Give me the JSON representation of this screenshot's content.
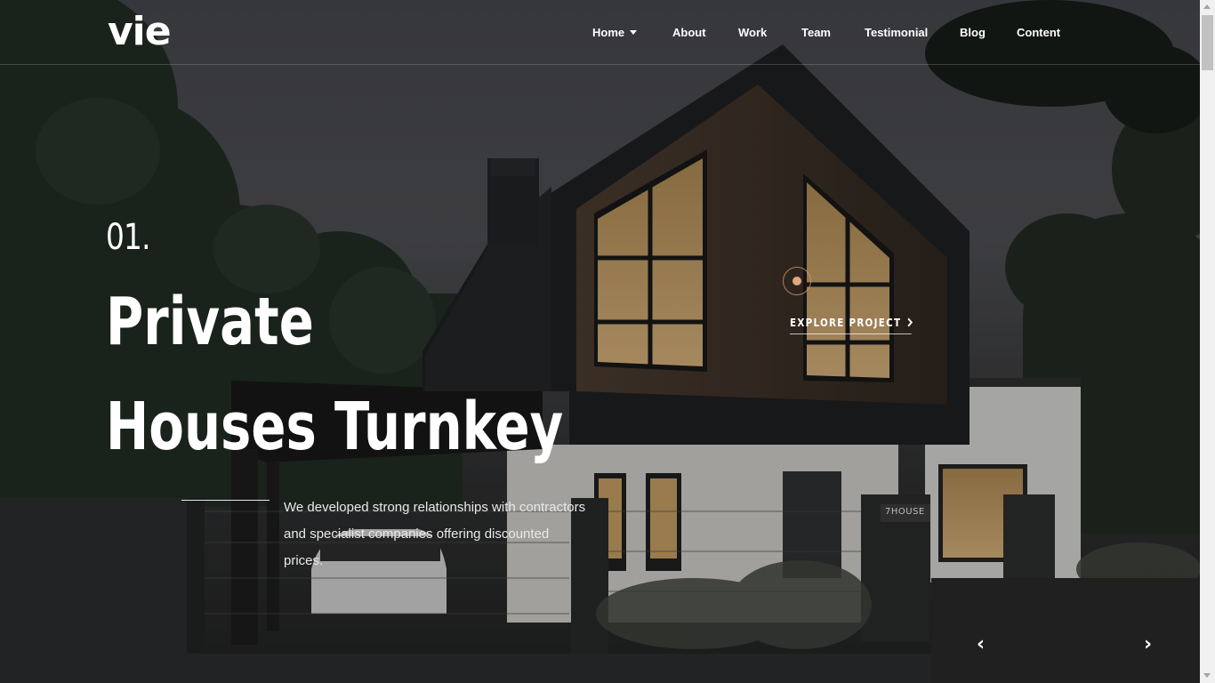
{
  "brand": {
    "logo_text": "vie"
  },
  "nav": {
    "items": [
      {
        "label": "Home",
        "has_dropdown": true
      },
      {
        "label": "About"
      },
      {
        "label": "Work"
      },
      {
        "label": "Team"
      },
      {
        "label": "Testimonial"
      },
      {
        "label": "Blog"
      },
      {
        "label": "Content"
      }
    ]
  },
  "slide": {
    "number": "01.",
    "title_line_1": "Private",
    "title_line_2": "Houses Turnkey",
    "description": "We developed strong relationships with contractors and specialist companies offering discounted prices.",
    "house_sign": "7HOUSE",
    "explore_label": "EXPLORE PROJECT"
  },
  "slider": {
    "prev_icon": "‹",
    "next_icon": "›"
  },
  "colors": {
    "accent": "#e3a67d",
    "panel": "#202021",
    "text": "#ffffff"
  }
}
